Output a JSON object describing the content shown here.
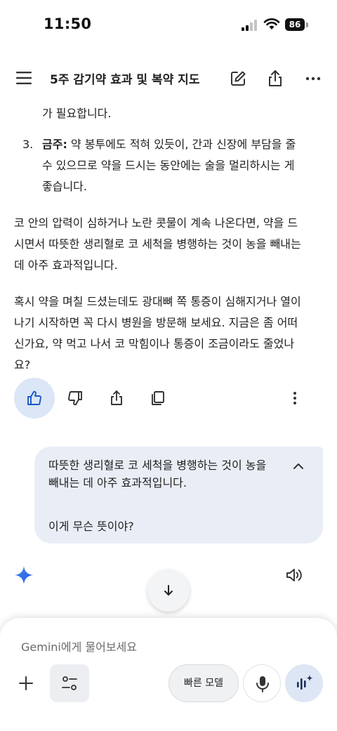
{
  "status": {
    "time": "11:50",
    "battery": "86"
  },
  "header": {
    "title": "5주 감기약 효과 및 복약 지도"
  },
  "response": {
    "cont_line": "가 필요합니다.",
    "list_num": "3.",
    "list_bold": "금주:",
    "list_line1": " 약 봉투에도 적혀 있듯이, 간과 신장에 부담을 줄",
    "list_line2": "수 있으므로 약을 드시는 동안에는 술을 멀리하시는 게",
    "list_line3": "좋습니다.",
    "para1_line1": "코 안의 압력이 심하거나 노란 콧물이 계속 나온다면, 약을 드",
    "para1_line2": "시면서 따뜻한 생리혈로 코 세척을 병행하는 것이 농을 빼내는",
    "para1_line3": "데 아주 효과적입니다.",
    "para2_line1": "혹시 약을 며칠 드셨는데도 광대뼈 쪽 통증이 심해지거나 열이",
    "para2_line2": "나기 시작하면 꼭 다시 병원을 방문해 보세요. 지금은 좀 어떠",
    "para2_line3": "신가요, 약 먹고 나서 코 막힘이나 통증이 조금이라도 줄었나",
    "para2_line4": "요?"
  },
  "user_message": {
    "quote_line1": "따뜻한 생리혈로 코 세척을 병행하는 것이 농을",
    "quote_line2": "빼내는 데 아주 효과적입니다.",
    "question": "이게 무슨 뜻이야?"
  },
  "input": {
    "placeholder": "Gemini에게 물어보세요",
    "model_label": "빠른 모델"
  },
  "colors": {
    "accent_blue": "#1a73e8",
    "bubble_bg": "#e9eef6",
    "liked_bg": "#dbe6f6"
  }
}
